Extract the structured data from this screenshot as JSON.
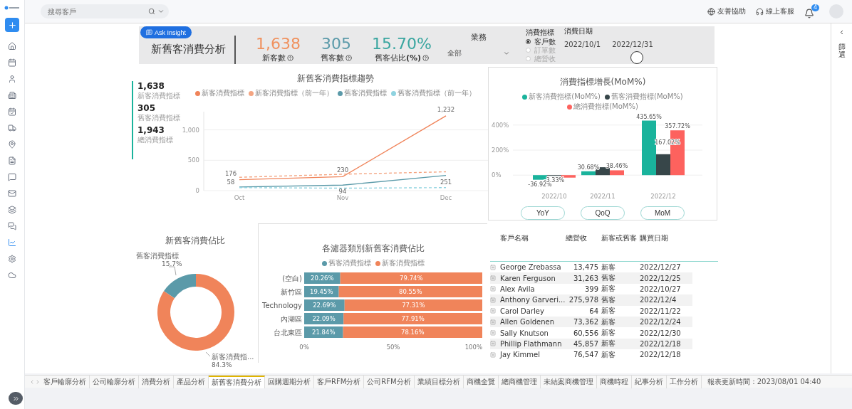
{
  "topbar": {
    "search": {
      "placeholder": "搜尋客戶"
    },
    "links": [
      "友善協助",
      "線上客服"
    ],
    "notification_count": "4"
  },
  "sidebar": {
    "items": [
      {
        "selected": false
      },
      {
        "selected": false
      },
      {
        "selected": false
      },
      {
        "selected": false
      },
      {
        "selected": false
      },
      {
        "selected": false
      },
      {
        "selected": false
      },
      {
        "selected": false
      },
      {
        "selected": false
      },
      {
        "selected": false
      },
      {
        "selected": false
      },
      {
        "selected": false
      },
      {
        "selected": true
      },
      {
        "selected": false
      },
      {
        "selected": false
      }
    ]
  },
  "header": {
    "ask_button": "Ask Insight",
    "title": "新舊客消費分析",
    "kpis": [
      {
        "value": "1,638",
        "label": "新客數",
        "color": "#f0925f"
      },
      {
        "value": "305",
        "label": "舊客數",
        "color": "#5b9aa9"
      },
      {
        "value": "15.70%",
        "label": "舊客佔比**(%)**",
        "color": "#3aa6a0"
      }
    ],
    "business": {
      "label": "業務",
      "value": "全部"
    },
    "metric": {
      "label": "消費指標",
      "options": [
        {
          "label": "客戶數",
          "selected": true
        },
        {
          "label": "訂單數",
          "selected": false
        },
        {
          "label": "總營收",
          "selected": false
        }
      ]
    },
    "date": {
      "label": "消費日期",
      "start": "2022/10/1",
      "end": "2022/12/31",
      "toggle_on": false
    }
  },
  "summary": [
    {
      "value": "1,638",
      "label": "新客消費指標"
    },
    {
      "value": "305",
      "label": "舊客消費指標"
    },
    {
      "value": "1,943",
      "label": "總消費指標"
    }
  ],
  "trend": {
    "chart_data": {
      "type": "line",
      "title": "新舊客消費指標趨勢",
      "legend": "top",
      "grid": true,
      "ylim": [
        0,
        1300
      ],
      "categories": [
        "Oct",
        "Nov",
        "Dec"
      ],
      "yticks": [
        0,
        500,
        {
          "value": 1000,
          "label": "1,000"
        }
      ],
      "series": [
        {
          "name": "新客消費指標",
          "color": "#f0845a",
          "line_style": "solid",
          "values": [
            180,
            230,
            1230
          ]
        },
        {
          "name": "新客消費指標（前一年）",
          "color": "#f4a582",
          "line_style": "dashed",
          "values": [
            220,
            270,
            310
          ]
        },
        {
          "name": "舊客消費指標",
          "color": "#5b9aa9",
          "line_style": "solid",
          "values": [
            60,
            90,
            250
          ]
        },
        {
          "name": "舊客消費指標（前一年）",
          "color": "#8fd3e0",
          "line_style": "dashed",
          "values": [
            50,
            40,
            50
          ]
        }
      ],
      "value_labels": [
        [
          "176",
          "230",
          "1,232"
        ],
        null,
        [
          "58",
          "94",
          "251"
        ],
        null
      ]
    }
  },
  "growth": {
    "chart_data": {
      "type": "bar",
      "title": "消費指標增長(MoM%)",
      "legend": "top",
      "grid": true,
      "categories": [
        "2022/10",
        "2022/11",
        "2022/12"
      ],
      "ylim": [
        -50,
        450
      ],
      "yticks": [
        {
          "value": 0,
          "label": "0%"
        },
        {
          "value": 200,
          "label": "200%"
        },
        {
          "value": 400,
          "label": "400%"
        }
      ],
      "series": [
        {
          "name": "新客消費指標(MoM%)",
          "color": "#1ab39c",
          "values": [
            -36.92,
            30.68,
            435.65
          ]
        },
        {
          "name": "舊客消費指標(MoM%)",
          "color": "#374649",
          "values": [
            -3.33,
            63,
            167.02
          ]
        },
        {
          "name": "總消費指標(MoM%)",
          "color": "#fd625e",
          "values": [
            -20,
            38.46,
            357.72
          ]
        }
      ],
      "value_labels": [
        [
          "-36.92%",
          "30.68%",
          "435.65%"
        ],
        [
          "-3.33%",
          null,
          "167.02%"
        ],
        [
          null,
          "38.46%",
          "357.72%"
        ]
      ]
    },
    "buttons": [
      "YoY",
      "QoQ",
      "MoM"
    ]
  },
  "share": {
    "chart_data": {
      "type": "donut",
      "title": "新舊客消費佔比",
      "categories": [
        "舊客消費指標",
        "新客消費指..."
      ],
      "values": [
        15.7,
        84.3
      ],
      "colors": [
        "#5b9aa9",
        "#f0845a"
      ],
      "value_labels": [
        "15.7%",
        "84.3%"
      ]
    }
  },
  "regions": {
    "chart_data": {
      "type": "bar",
      "orientation": "horizontal",
      "stacked": true,
      "title": "各濾器類別新舊客消費佔比",
      "legend": "top",
      "categories": [
        "(空白)",
        "新竹區",
        "Technology",
        "內湖區",
        "台北東區"
      ],
      "xlim": [
        0,
        100
      ],
      "series": [
        {
          "name": "舊客消費指標",
          "color": "#5b9aa9",
          "values": [
            20.26,
            19.45,
            22.69,
            22.09,
            21.84
          ]
        },
        {
          "name": "新客消費指標",
          "color": "#f0845a",
          "values": [
            79.74,
            80.55,
            77.31,
            77.91,
            78.16
          ]
        }
      ],
      "xticks": [
        {
          "value": 0,
          "label": "0%"
        },
        {
          "value": 50,
          "label": "50%"
        },
        {
          "value": 100,
          "label": "100%"
        }
      ],
      "value_labels": [
        [
          "20.26%",
          "19.45%",
          "22.69%",
          "22.09%",
          "21.84%"
        ],
        [
          "79.74%",
          "80.55%",
          "77.31%",
          "77.91%",
          "78.16%"
        ]
      ]
    }
  },
  "table": {
    "columns": [
      "客戶名稱",
      "總營收",
      "新客或舊客",
      "購買日期"
    ],
    "rows": [
      [
        "George Zrebassa",
        "13,475",
        "新客",
        "2022/12/27"
      ],
      [
        "Karen Ferguson",
        "31,263",
        "舊客",
        "2022/12/25"
      ],
      [
        "Alex Avila",
        "399",
        "新客",
        "2022/10/27"
      ],
      [
        "Anthony Garveri...",
        "275,978",
        "舊客",
        "2022/12/4"
      ],
      [
        "Carol Darley",
        "64",
        "新客",
        "2022/11/22"
      ],
      [
        "Allen Goldenen",
        "73,362",
        "新客",
        "2022/12/24"
      ],
      [
        "Sally Knutson",
        "60,556",
        "新客",
        "2022/12/30"
      ],
      [
        "Phillip Flathmann",
        "45,857",
        "新客",
        "2022/12/18"
      ],
      [
        "Jay Kimmel",
        "76,547",
        "新客",
        "2022/12/18"
      ]
    ]
  },
  "filter_panel": {
    "label": "篩選"
  },
  "tabs": [
    {
      "label": "客戶輪廓分析",
      "selected": false
    },
    {
      "label": "公司輪廓分析",
      "selected": false
    },
    {
      "label": "消費分析",
      "selected": false
    },
    {
      "label": "產品分析",
      "selected": false
    },
    {
      "label": "新舊客消費分析",
      "selected": true
    },
    {
      "label": "回購週期分析",
      "selected": false
    },
    {
      "label": "客戶RFM分析",
      "selected": false
    },
    {
      "label": "公司RFM分析",
      "selected": false
    },
    {
      "label": "業績目標分析",
      "selected": false
    },
    {
      "label": "商機全覽",
      "selected": false
    },
    {
      "label": "總商機管理",
      "selected": false
    },
    {
      "label": "未結案商機管理",
      "selected": false
    },
    {
      "label": "商機時程",
      "selected": false
    },
    {
      "label": "紀事分析",
      "selected": false
    },
    {
      "label": "工作分析",
      "selected": false
    }
  ],
  "status": "報表更新時間：2023/08/01 04:40"
}
